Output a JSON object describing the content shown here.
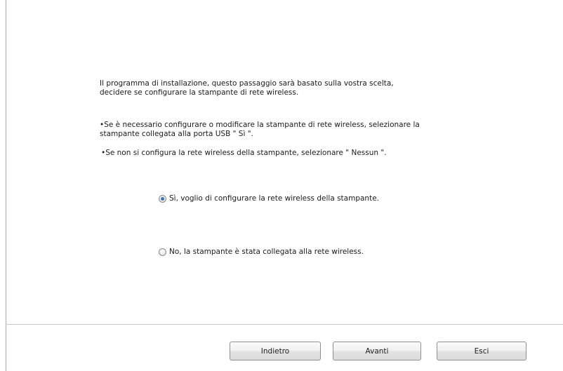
{
  "description": {
    "intro": "Il programma di installazione, questo passaggio sarà basato sulla vostra scelta,\ndecidere se configurare la stampante di rete wireless.",
    "bullet_configure": "•Se è necessario configurare o modificare la stampante di rete wireless, selezionare la\nstampante collegata alla porta USB \" Sì \".",
    "bullet_none": "•Se non si configura la rete wireless della stampante, selezionare \" Nessun \"."
  },
  "options": {
    "yes": {
      "label": "Sì, voglio di configurare la rete wireless della stampante.",
      "selected": true
    },
    "no": {
      "label": "No, la stampante è stata collegata alla rete wireless.",
      "selected": false
    }
  },
  "buttons": {
    "back": "Indietro",
    "next": "Avanti",
    "exit": "Esci"
  },
  "colors": {
    "radio_dot": "#3c6fb4",
    "separator": "#c9c9c9"
  }
}
